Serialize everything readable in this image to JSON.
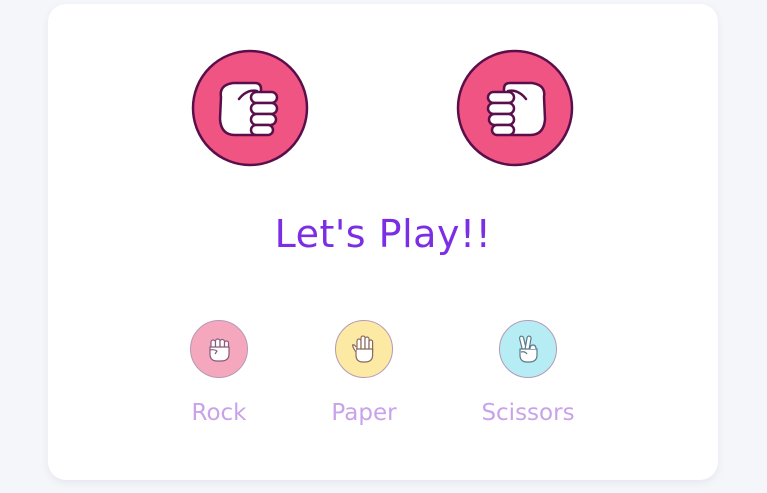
{
  "game": {
    "status_text": "Let's Play!!",
    "user_hand_icon": "fist-icon",
    "computer_hand_icon": "fist-icon"
  },
  "choices": [
    {
      "label": "Rock",
      "icon": "rock-hand-icon",
      "color": "#f4a7bd"
    },
    {
      "label": "Paper",
      "icon": "paper-hand-icon",
      "color": "#fbe9a4"
    },
    {
      "label": "Scissors",
      "icon": "scissors-hand-icon",
      "color": "#b6ecf3"
    }
  ],
  "colors": {
    "hand_circle": "#f05482",
    "hand_outline": "#5a0f4a",
    "status_text": "#7b2ee3",
    "choice_label": "#c9a3ea",
    "background": "#f5f6fa",
    "card": "#ffffff"
  }
}
